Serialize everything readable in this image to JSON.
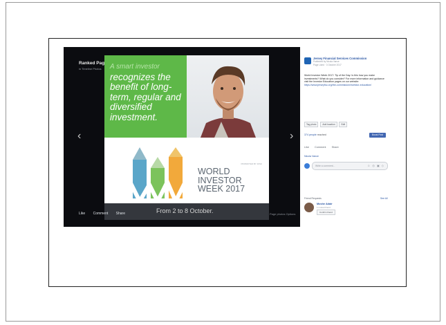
{
  "viewer": {
    "title": "Ranked Page photos",
    "subtitle": "in Timeline Photos",
    "prev_arrow": "‹",
    "next_arrow": "›",
    "image": {
      "headline_faint": "A smart investor",
      "headline": "recognizes the benefit of long-term, regular and diversified investment.",
      "logo_caption": "PROMOTED BY JFSC",
      "event_line1": "WORLD",
      "event_line2": "INVESTOR",
      "event_line3": "WEEK 2017",
      "dates": "From 2 to 8 October."
    },
    "actions": [
      "Like",
      "Comment",
      "Share"
    ],
    "right_links": "Page photos   Options"
  },
  "panel": {
    "close": "×",
    "page_name": "Jersey Financial Services Commission",
    "meta1": "Published by Nicola Vance",
    "meta2": "Page Liked · 3 October 2017",
    "post_text": "World Investor Week 2017: Tip of the Day: Is this how you make investments? What do you consider? For more information and guidance visit the Investor Education pages on our website:",
    "post_link": "https://www.jerseyfsc.org/the-commission/investor-education/",
    "buttons": [
      "Tag photo",
      "Add location",
      "Edit"
    ],
    "reach_count": "374 people",
    "reach_label": "reached",
    "boost_label": "Boost Post",
    "post_actions": [
      "Like",
      "Comment",
      "Share"
    ],
    "commenter": "Nicola Vance",
    "comment_placeholder": "Write a comment...",
    "comment_icons": "☺ ◎ ▣ ◇",
    "friend_requests_title": "Friend Requests",
    "see_all": "See All",
    "friend_name": "Moshe Adair",
    "friend_mutual": "1 mutual friend",
    "confirm_label": "Confirm friend"
  },
  "colors": {
    "green": "#5eb848",
    "facebook_blue": "#4267b2",
    "link": "#2a56a4"
  }
}
